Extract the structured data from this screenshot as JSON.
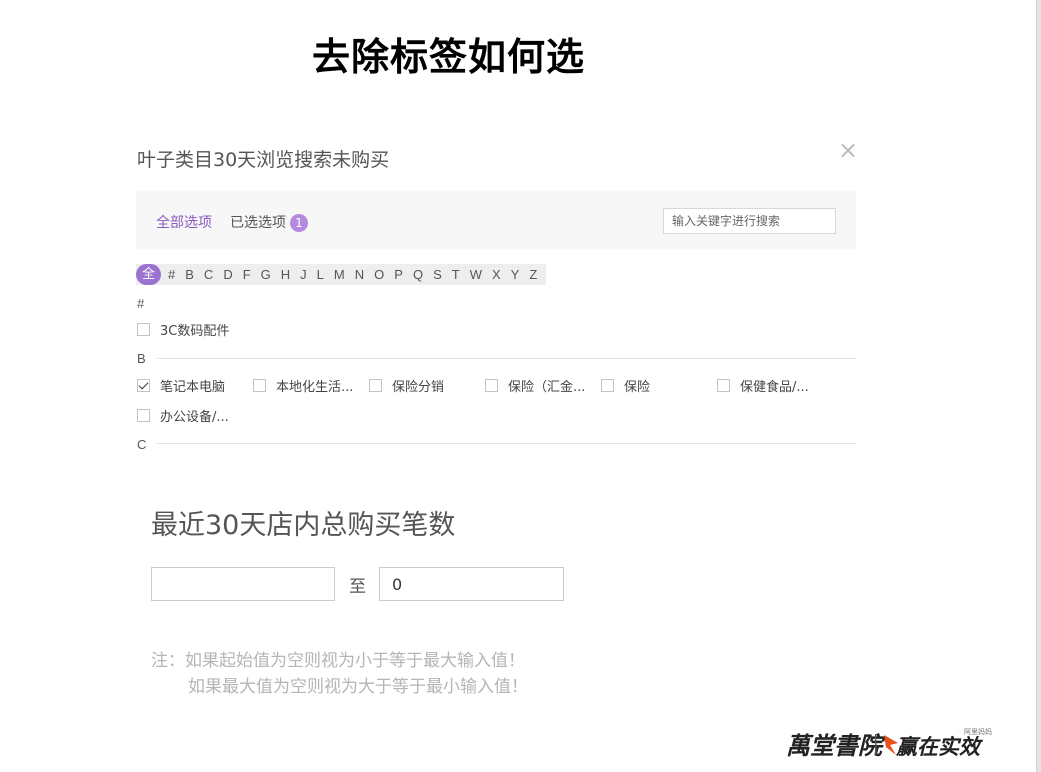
{
  "slide": {
    "title": "去除标签如何选"
  },
  "dialog": {
    "title": "叶子类目30天浏览搜索未购买",
    "close_label": "×",
    "tabs": {
      "all": "全部选项",
      "selected": "已选选项",
      "selected_count": "1"
    },
    "search_placeholder": "输入关键字进行搜索",
    "alphabet": [
      "全",
      "#",
      "B",
      "C",
      "D",
      "F",
      "G",
      "H",
      "J",
      "L",
      "M",
      "N",
      "O",
      "P",
      "Q",
      "S",
      "T",
      "W",
      "X",
      "Y",
      "Z"
    ],
    "groups": [
      {
        "label": "#",
        "items": [
          {
            "label": "3C数码配件",
            "checked": false
          }
        ]
      },
      {
        "label": "B",
        "items": [
          {
            "label": "笔记本电脑",
            "checked": true
          },
          {
            "label": "本地化生活...",
            "checked": false
          },
          {
            "label": "保险分销",
            "checked": false
          },
          {
            "label": "保险（汇金...",
            "checked": false
          },
          {
            "label": "保险",
            "checked": false
          },
          {
            "label": "保健食品/...",
            "checked": false
          },
          {
            "label": "办公设备/...",
            "checked": false
          }
        ]
      },
      {
        "label": "C",
        "items": []
      }
    ]
  },
  "purchase": {
    "title": "最近30天店内总购买笔数",
    "min_value": "",
    "separator": "至",
    "max_value": "0",
    "note_line1": "注：如果起始值为空则视为小于等于最大输入值！",
    "note_line2": "如果最大值为空则视为大于等于最小输入值！"
  },
  "footer": {
    "logo_left": "万堂书院",
    "logo_right": "赢在实效",
    "logo_small": "阿里妈妈",
    "accent_color": "#e8501e"
  },
  "colors": {
    "accent": "#9b72cf",
    "badge": "#b48ae0"
  }
}
